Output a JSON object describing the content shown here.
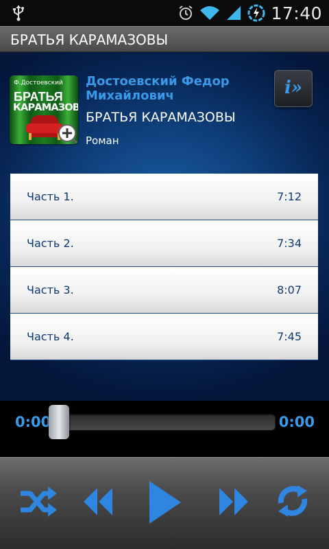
{
  "status_bar": {
    "time": "17:40",
    "icons": [
      "usb-icon",
      "alarm-icon",
      "wifi-icon",
      "signal-icon",
      "battery-charging-icon"
    ]
  },
  "title_bar": {
    "title": "БРАТЬЯ КАРАМАЗОВЫ"
  },
  "book": {
    "cover": {
      "author_line": "Ф.Достоевский",
      "title_line1": "БРАТЬЯ",
      "title_line2": "КАРАМАЗОВЫ"
    },
    "author": "Достоевский Федор Михайлович",
    "title": "БРАТЬЯ КАРАМАЗОВЫ",
    "genre": "Роман",
    "info_icon": "info-icon"
  },
  "parts": [
    {
      "name": "Часть 1.",
      "duration": "7:12"
    },
    {
      "name": "Часть 2.",
      "duration": "7:34"
    },
    {
      "name": "Часть 3.",
      "duration": "8:07"
    },
    {
      "name": "Часть 4.",
      "duration": "7:45"
    }
  ],
  "player": {
    "elapsed": "0:00",
    "total": "0:00",
    "progress": 0
  },
  "controls": [
    "shuffle-icon",
    "rewind-icon",
    "play-icon",
    "fast-forward-icon",
    "repeat-icon"
  ],
  "colors": {
    "accent": "#3a9ae8",
    "background": "#0e3e78",
    "row_text": "#0e3a6e"
  }
}
